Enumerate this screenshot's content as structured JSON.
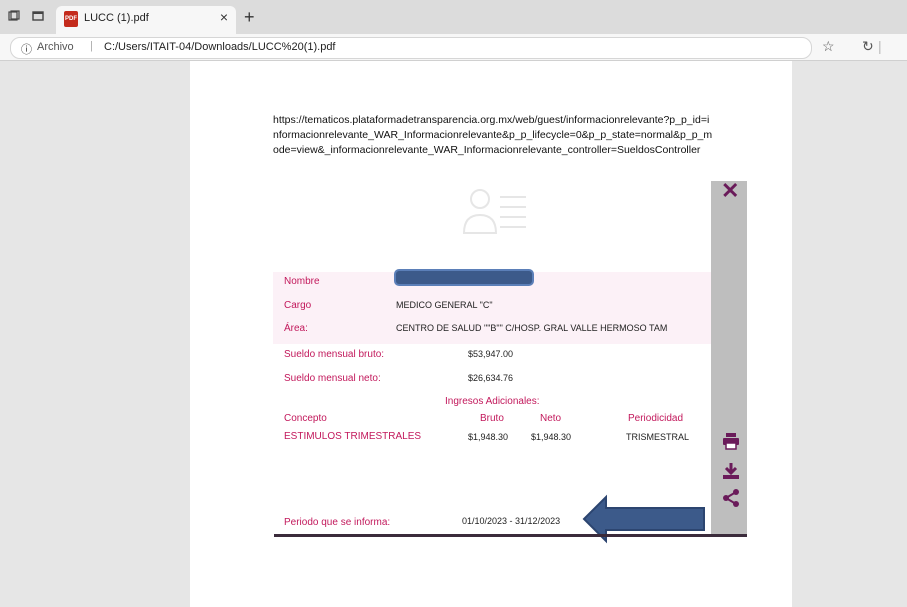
{
  "tab": {
    "title": "LUCC (1).pdf",
    "pdf_badge": "PDF"
  },
  "address": {
    "info_label": "Archivo",
    "path": "C:/Users/ITAIT-04/Downloads/LUCC%20(1).pdf"
  },
  "document": {
    "source_url": "https://tematicos.plataformadetransparencia.org.mx/web/guest/informacionrelevante?p_p_id=informacionrelevante_WAR_Informacionrelevante&p_p_lifecycle=0&p_p_state=normal&p_p_mode=view&_informacionrelevante_WAR_Informacionrelevante_controller=SueldosController",
    "fields": {
      "nombre_label": "Nombre",
      "cargo_label": "Cargo",
      "cargo_value": "MEDICO GENERAL \"C\"",
      "area_label": "Área:",
      "area_value": "CENTRO DE SALUD \"\"B\"\" C/HOSP. GRAL VALLE HERMOSO TAM",
      "bruto_label": "Sueldo mensual bruto:",
      "bruto_value": "$53,947.00",
      "neto_label": "Sueldo mensual neto:",
      "neto_value": "$26,634.76",
      "ingresos_title": "Ingresos Adicionales:",
      "periodo_label": "Periodo que se informa:",
      "periodo_value": "01/10/2023 - 31/12/2023"
    },
    "table": {
      "headers": [
        "Concepto",
        "Bruto",
        "Neto",
        "Periodicidad"
      ],
      "rows": [
        [
          "ESTIMULOS TRIMESTRALES",
          "$1,948.30",
          "$1,948.30",
          "TRISMESTRAL"
        ]
      ]
    }
  },
  "icons": [
    "pdf-icon",
    "info-icon",
    "favorite-icon",
    "refresh-icon",
    "close-icon",
    "person-card-icon",
    "print-icon",
    "download-icon",
    "share-icon",
    "arrow-left-icon"
  ],
  "colors": {
    "accent": "#c2185b",
    "icon": "#6a1b5a",
    "redaction": "#3c5a8a"
  }
}
